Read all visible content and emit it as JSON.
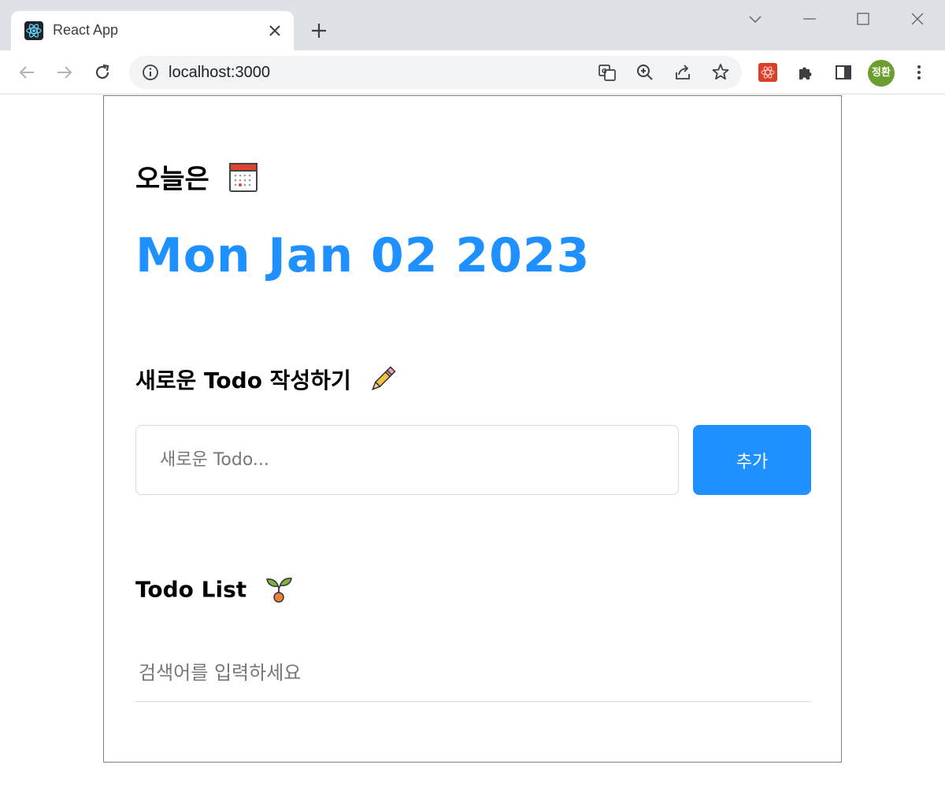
{
  "browser": {
    "tab_title": "React App",
    "url": "localhost:3000",
    "profile_initials": "정환"
  },
  "app": {
    "today_label": "오늘은",
    "date": "Mon Jan 02 2023",
    "new_todo_label": "새로운 Todo 작성하기",
    "new_todo_placeholder": "새로운 Todo...",
    "add_button": "추가",
    "todo_list_label": "Todo List",
    "search_placeholder": "검색어를 입력하세요"
  },
  "colors": {
    "accent": "#1e90ff",
    "frame_border": "#808080"
  },
  "icons": [
    "react-favicon-icon",
    "close-icon",
    "plus-icon",
    "back-icon",
    "forward-icon",
    "reload-icon",
    "info-icon",
    "translate-icon",
    "zoom-icon",
    "share-icon",
    "star-icon",
    "extension-icon",
    "puzzle-icon",
    "side-panel-icon",
    "more-icon",
    "calendar-icon",
    "pencil-icon",
    "seedling-icon"
  ]
}
